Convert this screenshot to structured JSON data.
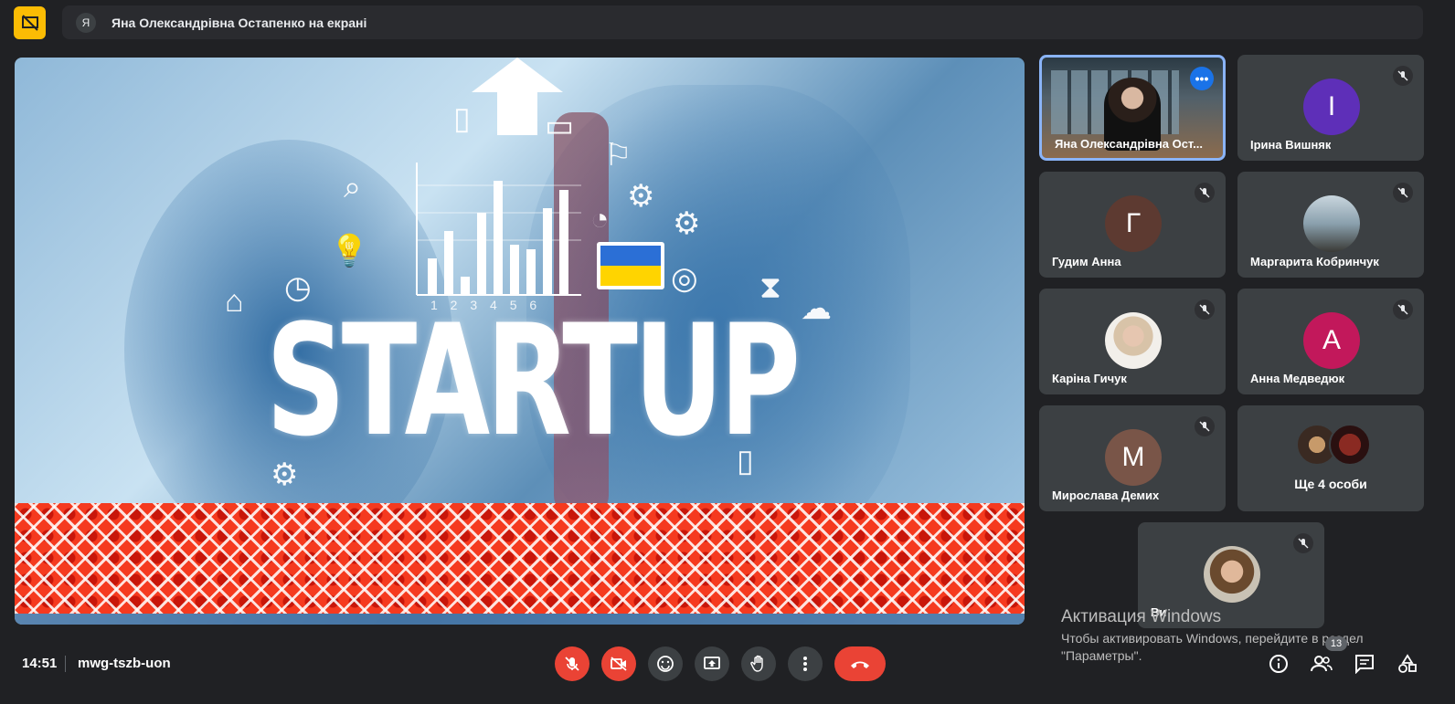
{
  "topbar": {
    "presenter_avatar_letter": "Я",
    "presenter_text": "Яна Олександрівна Остапенко на екрані"
  },
  "stage": {
    "slide_word": "STARTUP",
    "chart_numbers": "1 2 3 4 5 6"
  },
  "participants": [
    {
      "name": "Яна Олександрівна Ост...",
      "type": "video",
      "self": true
    },
    {
      "name": "Ірина Вишняк",
      "letter": "I",
      "color": "#5e2fb8",
      "muted": true
    },
    {
      "name": "Гудим Анна",
      "letter": "Г",
      "color": "#5d3a31",
      "muted": true
    },
    {
      "name": "Маргарита Кобринчук",
      "type": "photo",
      "muted": true
    },
    {
      "name": "Каріна Гичук",
      "type": "photo",
      "muted": true
    },
    {
      "name": "Анна Медведюк",
      "letter": "А",
      "color": "#c2185b",
      "muted": true
    },
    {
      "name": "Мирослава Демих",
      "letter": "М",
      "color": "#795548",
      "muted": true
    },
    {
      "name": "Ще 4 особи",
      "type": "overflow"
    },
    {
      "name": "Ви",
      "type": "photo",
      "muted": true
    }
  ],
  "watermark": {
    "title": "Активация Windows",
    "subtitle": "Чтобы активировать Windows, перейдите в раздел \"Параметры\"."
  },
  "bottombar": {
    "time": "14:51",
    "meeting_code": "mwg-tszb-uon",
    "people_count": "13"
  },
  "icons": {
    "present": "present-off-icon",
    "mic": "mic-off-icon",
    "cam": "camera-off-icon",
    "emoji": "emoji-icon",
    "share": "present-screen-icon",
    "hand": "raise-hand-icon",
    "more": "more-vert-icon",
    "end": "call-end-icon",
    "info": "info-icon",
    "people": "people-icon",
    "chat": "chat-icon",
    "activities": "activities-icon"
  },
  "colors": {
    "accent_yellow": "#fbbc04",
    "danger_red": "#ea4335",
    "self_border": "#8ab4f8"
  }
}
